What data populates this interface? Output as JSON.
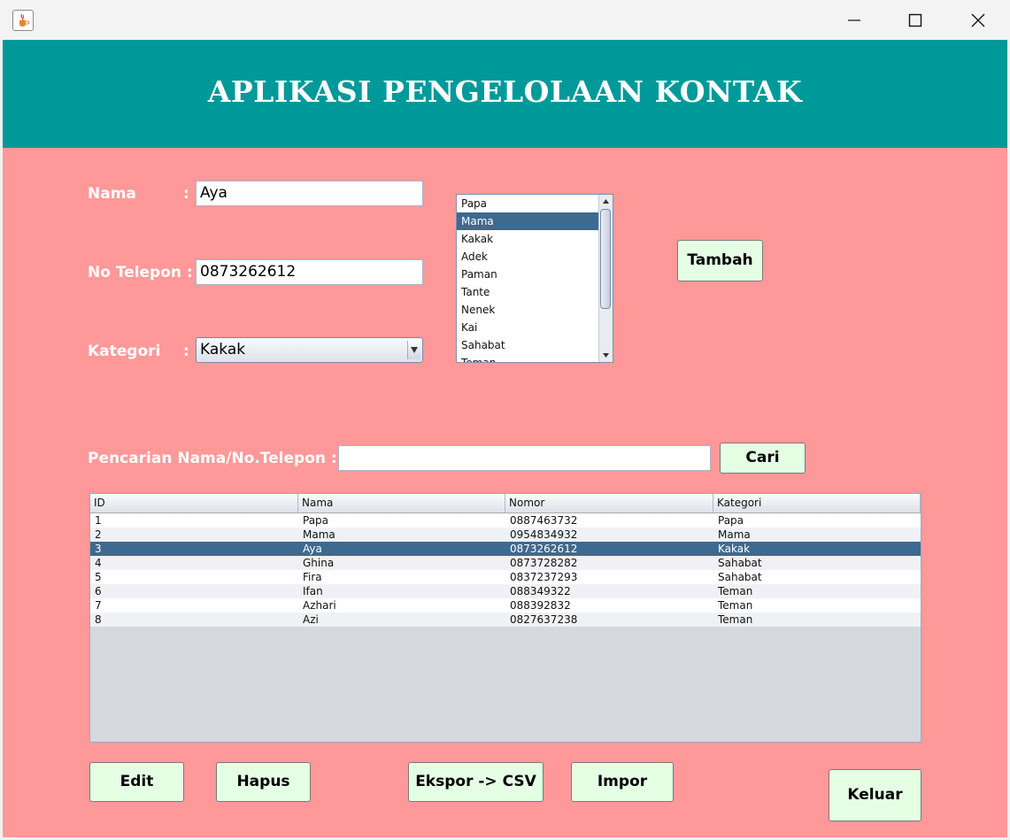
{
  "window": {
    "title": "",
    "icon": "java-cup-icon"
  },
  "header": {
    "title": "APLIKASI PENGELOLAAN KONTAK"
  },
  "form": {
    "nama_label": "Nama",
    "nama_colon": ":",
    "nama_value": "Aya",
    "telepon_label": "No Telepon :",
    "telepon_value": "0873262612",
    "kategori_label": "Kategori",
    "kategori_colon": ":",
    "kategori_selected": "Kakak"
  },
  "category_list": {
    "items": [
      "Papa",
      "Mama",
      "Kakak",
      "Adek",
      "Paman",
      "Tante",
      "Nenek",
      "Kai",
      "Sahabat",
      "Teman"
    ],
    "selected_index": 1
  },
  "buttons": {
    "tambah": "Tambah",
    "cari": "Cari",
    "edit": "Edit",
    "hapus": "Hapus",
    "ekspor": "Ekspor -> CSV",
    "impor": "Impor",
    "keluar": "Keluar"
  },
  "search": {
    "label": "Pencarian Nama/No.Telepon :",
    "value": ""
  },
  "table": {
    "columns": [
      "ID",
      "Nama",
      "Nomor",
      "Kategori"
    ],
    "rows": [
      [
        "1",
        "Papa",
        "0887463732",
        "Papa"
      ],
      [
        "2",
        "Mama",
        "0954834932",
        "Mama"
      ],
      [
        "3",
        "Aya",
        "0873262612",
        "Kakak"
      ],
      [
        "4",
        "Ghina",
        "0873728282",
        "Sahabat"
      ],
      [
        "5",
        "Fira",
        "0837237293",
        "Sahabat"
      ],
      [
        "6",
        "Ifan",
        "088349322",
        "Teman"
      ],
      [
        "7",
        "Azhari",
        "088392832",
        "Teman"
      ],
      [
        "8",
        "Azi",
        "0827637238",
        "Teman"
      ]
    ],
    "selected_row": 2
  },
  "colors": {
    "header_bg": "#009999",
    "content_bg": "#ff9999",
    "button_bg": "#e5ffe5",
    "selection": "#3e6a8f"
  }
}
